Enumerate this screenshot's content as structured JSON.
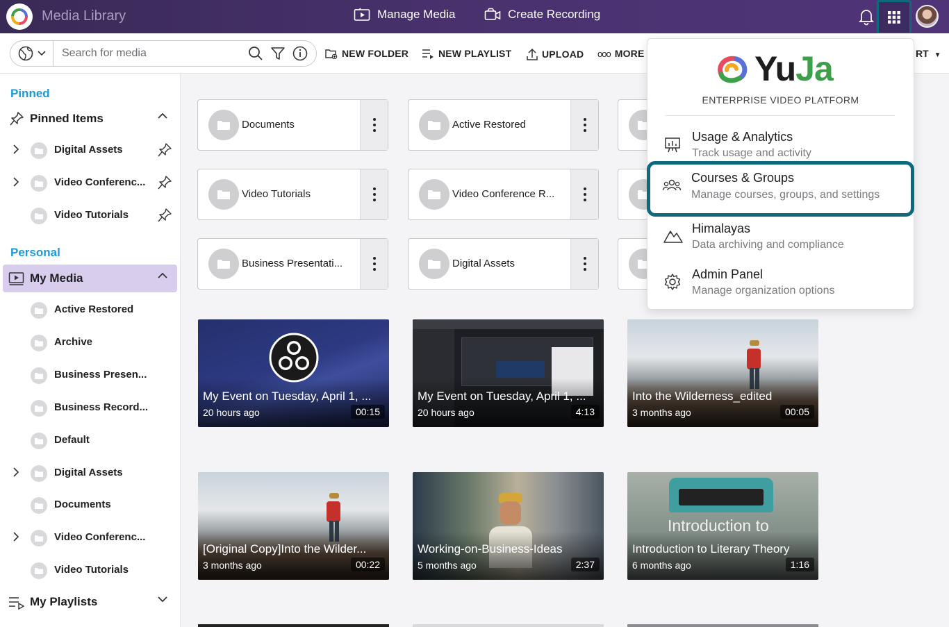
{
  "app": {
    "title": "Media Library"
  },
  "topnav": {
    "manage_media": "Manage Media",
    "create_recording": "Create Recording"
  },
  "search": {
    "placeholder": "Search for media"
  },
  "toolbar": {
    "new_folder": "NEW FOLDER",
    "new_playlist": "NEW PLAYLIST",
    "upload": "UPLOAD",
    "more": "MORE",
    "sort_tail": "RT"
  },
  "sidebar": {
    "pinned_title": "Pinned",
    "pinned_group": "Pinned Items",
    "pinned_items": [
      "Digital Assets",
      "Video Conferenc...",
      "Video Tutorials"
    ],
    "personal_title": "Personal",
    "my_media": "My Media",
    "my_media_items": [
      "Active Restored",
      "Archive",
      "Business Presen...",
      "Business Record...",
      "Default",
      "Digital Assets",
      "Documents",
      "Video Conferenc...",
      "Video Tutorials"
    ],
    "my_playlists": "My Playlists"
  },
  "folders": [
    {
      "name": "Documents"
    },
    {
      "name": "Active Restored"
    },
    {
      "name": "Video Tutorials"
    },
    {
      "name": "Video Conference R..."
    },
    {
      "name": "Business Presentati..."
    },
    {
      "name": "Digital Assets"
    }
  ],
  "media": [
    {
      "title": "My Event on Tuesday, April 1, ...",
      "ago": "20 hours ago",
      "duration": "00:15"
    },
    {
      "title": "My Event on Tuesday, April 1, ...",
      "ago": "20 hours ago",
      "duration": "4:13"
    },
    {
      "title": "Into the Wilderness_edited",
      "ago": "3 months ago",
      "duration": "00:05"
    },
    {
      "title": "[Original Copy]Into the Wilder...",
      "ago": "3 months ago",
      "duration": "00:22"
    },
    {
      "title": "Working-on-Business-Ideas",
      "ago": "5 months ago",
      "duration": "2:37"
    },
    {
      "title": "Introduction to Literary Theory",
      "ago": "6 months ago",
      "duration": "1:16",
      "overlay": "Introduction to"
    }
  ],
  "menu": {
    "brand": "YuJa",
    "tagline": "ENTERPRISE VIDEO PLATFORM",
    "items": [
      {
        "title": "Usage & Analytics",
        "desc": "Track usage and activity"
      },
      {
        "title": "Courses & Groups",
        "desc": "Manage courses, groups, and settings"
      },
      {
        "title": "Himalayas",
        "desc": "Data archiving and compliance"
      },
      {
        "title": "Admin Panel",
        "desc": "Manage organization options"
      }
    ]
  },
  "colors": {
    "topbar": "#4a3270",
    "accent_blue": "#1a9bd7",
    "highlight": "#0c6a7a",
    "active_row": "#d9cdee"
  }
}
